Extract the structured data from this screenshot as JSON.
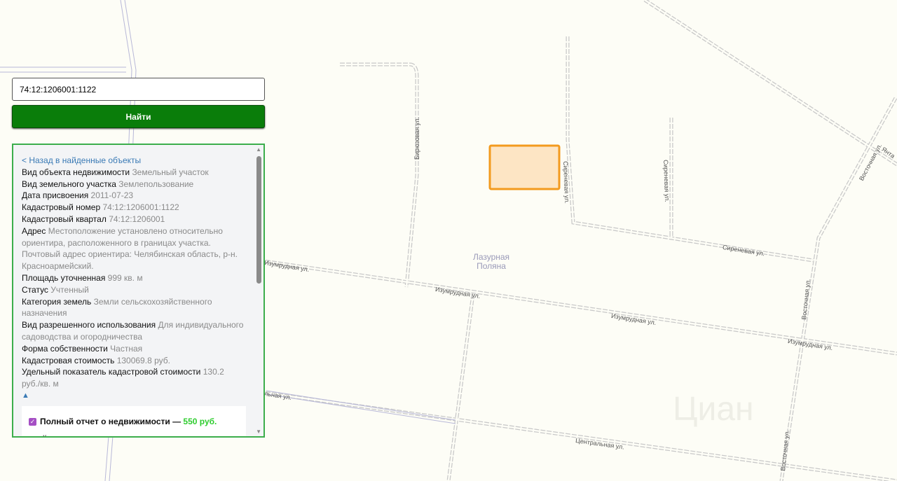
{
  "search": {
    "value": "74:12:1206001:1122",
    "button": "Найти"
  },
  "panel": {
    "back_link": "< Назад в найденные объекты",
    "fields": [
      {
        "label": "Вид объекта недвижимости",
        "value": "Земельный участок"
      },
      {
        "label": "Вид земельного участка",
        "value": "Землепользование"
      },
      {
        "label": "Дата присвоения",
        "value": "2011-07-23"
      },
      {
        "label": "Кадастровый номер",
        "value": "74:12:1206001:1122"
      },
      {
        "label": "Кадастровый квартал",
        "value": "74:12:1206001"
      },
      {
        "label": "Адрес",
        "value": "Местоположение установлено относительно ориентира, расположенного в границах участка. Почтовый адрес ориентира: Челябинская область, р-н. Красноармейский."
      },
      {
        "label": "Площадь уточненная",
        "value": "999 кв. м"
      },
      {
        "label": "Статус",
        "value": "Учтенный"
      },
      {
        "label": "Категория земель",
        "value": "Земли сельскохозяйственного назначения"
      },
      {
        "label": "Вид разрешенного использования",
        "value": "Для индивидуального садоводства и огородничества"
      },
      {
        "label": "Форма собственности",
        "value": "Частная"
      },
      {
        "label": "Кадастровая стоимость",
        "value": "130069.8 руб."
      },
      {
        "label": "Удельный показатель кадастровой стоимости",
        "value": "130.2 руб./кв. м"
      }
    ],
    "collapse": "▲",
    "report": {
      "title": "Полный отчет о недвижимости — ",
      "price": "550 руб.",
      "items": [
        "Кадастровая стоимость,"
      ]
    }
  },
  "map": {
    "place": "Лазурная Поляна",
    "streets": {
      "biryuz": "Бирюзовая ул.",
      "siren1": "Сиреневая ул.",
      "siren2": "Сиреневая ул.",
      "siren3": "Сиреневая ул.",
      "izum1": "Изумрудная ул.",
      "izum2": "Изумрудная ул.",
      "izum3": "Изумрудная ул.",
      "izum4": "Изумрудная ул.",
      "vost1": "Восточная ул.",
      "vost2": "Восточная ул.",
      "vost3": "Восточная ул.",
      "centr": "Центральная ул.",
      "yant": "Янта",
      "other": "льная ул."
    },
    "parcel_fill": "#fde5c4",
    "parcel_stroke": "#f39a1e",
    "watermark": "Циан"
  }
}
